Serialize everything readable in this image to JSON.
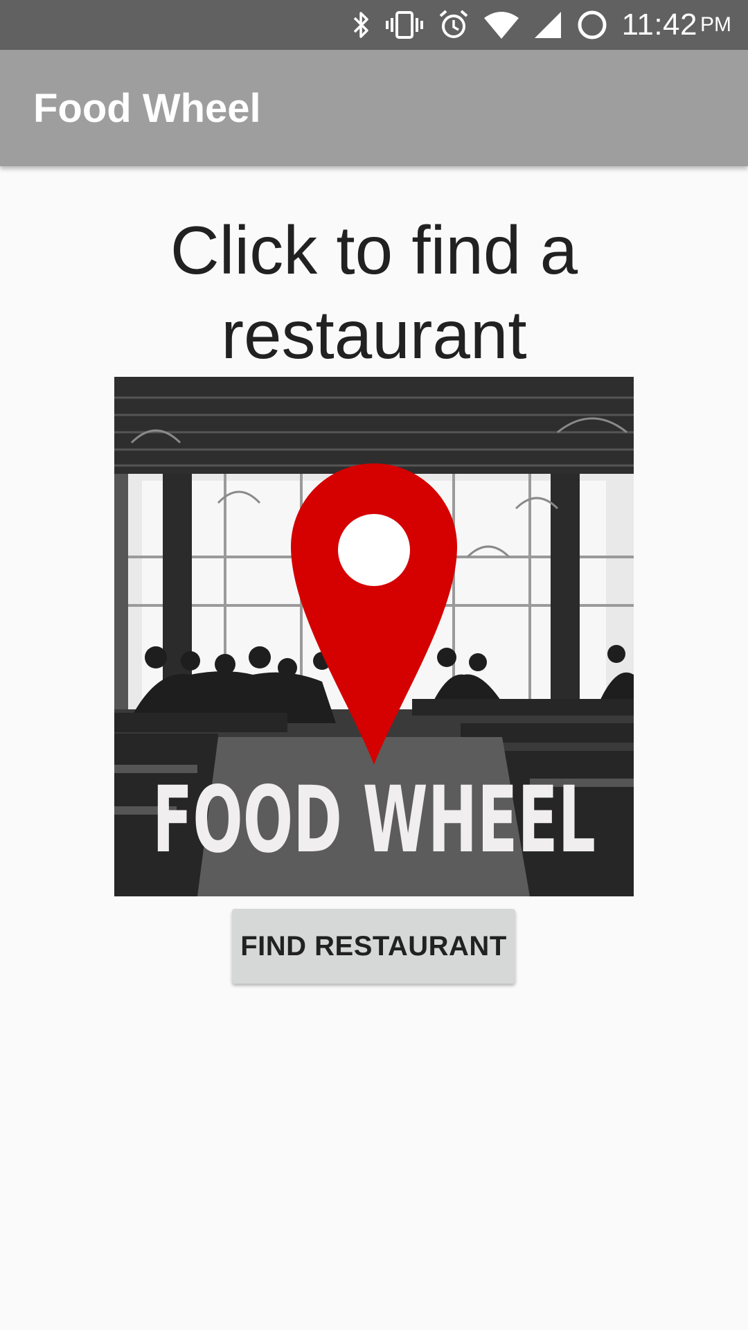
{
  "status_bar": {
    "time": "11:42",
    "ampm": "PM",
    "icons": [
      "bluetooth-icon",
      "vibrate-icon",
      "alarm-icon",
      "wifi-icon",
      "cell-signal-icon",
      "sync-circle-icon"
    ]
  },
  "app_bar": {
    "title": "Food Wheel",
    "color": "#9e9e9e"
  },
  "main": {
    "headline": "Click to find a restaurant",
    "logo": {
      "text": "FOOD WHEEL",
      "pin_color": "#d50000"
    },
    "find_button_label": "FIND RESTAURANT"
  }
}
